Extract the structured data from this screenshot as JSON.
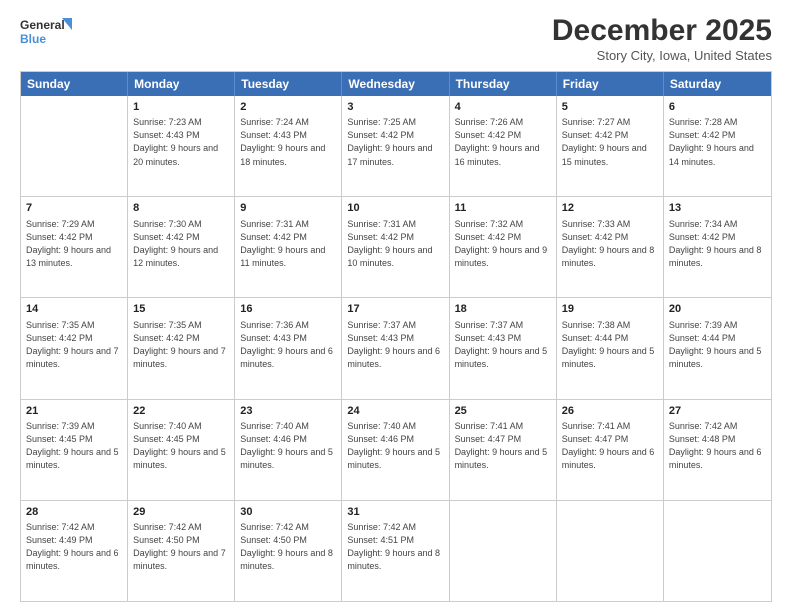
{
  "logo": {
    "line1": "General",
    "line2": "Blue"
  },
  "title": "December 2025",
  "location": "Story City, Iowa, United States",
  "header_days": [
    "Sunday",
    "Monday",
    "Tuesday",
    "Wednesday",
    "Thursday",
    "Friday",
    "Saturday"
  ],
  "weeks": [
    [
      {
        "day": "",
        "sunrise": "",
        "sunset": "",
        "daylight": ""
      },
      {
        "day": "1",
        "sunrise": "Sunrise: 7:23 AM",
        "sunset": "Sunset: 4:43 PM",
        "daylight": "Daylight: 9 hours and 20 minutes."
      },
      {
        "day": "2",
        "sunrise": "Sunrise: 7:24 AM",
        "sunset": "Sunset: 4:43 PM",
        "daylight": "Daylight: 9 hours and 18 minutes."
      },
      {
        "day": "3",
        "sunrise": "Sunrise: 7:25 AM",
        "sunset": "Sunset: 4:42 PM",
        "daylight": "Daylight: 9 hours and 17 minutes."
      },
      {
        "day": "4",
        "sunrise": "Sunrise: 7:26 AM",
        "sunset": "Sunset: 4:42 PM",
        "daylight": "Daylight: 9 hours and 16 minutes."
      },
      {
        "day": "5",
        "sunrise": "Sunrise: 7:27 AM",
        "sunset": "Sunset: 4:42 PM",
        "daylight": "Daylight: 9 hours and 15 minutes."
      },
      {
        "day": "6",
        "sunrise": "Sunrise: 7:28 AM",
        "sunset": "Sunset: 4:42 PM",
        "daylight": "Daylight: 9 hours and 14 minutes."
      }
    ],
    [
      {
        "day": "7",
        "sunrise": "Sunrise: 7:29 AM",
        "sunset": "Sunset: 4:42 PM",
        "daylight": "Daylight: 9 hours and 13 minutes."
      },
      {
        "day": "8",
        "sunrise": "Sunrise: 7:30 AM",
        "sunset": "Sunset: 4:42 PM",
        "daylight": "Daylight: 9 hours and 12 minutes."
      },
      {
        "day": "9",
        "sunrise": "Sunrise: 7:31 AM",
        "sunset": "Sunset: 4:42 PM",
        "daylight": "Daylight: 9 hours and 11 minutes."
      },
      {
        "day": "10",
        "sunrise": "Sunrise: 7:31 AM",
        "sunset": "Sunset: 4:42 PM",
        "daylight": "Daylight: 9 hours and 10 minutes."
      },
      {
        "day": "11",
        "sunrise": "Sunrise: 7:32 AM",
        "sunset": "Sunset: 4:42 PM",
        "daylight": "Daylight: 9 hours and 9 minutes."
      },
      {
        "day": "12",
        "sunrise": "Sunrise: 7:33 AM",
        "sunset": "Sunset: 4:42 PM",
        "daylight": "Daylight: 9 hours and 8 minutes."
      },
      {
        "day": "13",
        "sunrise": "Sunrise: 7:34 AM",
        "sunset": "Sunset: 4:42 PM",
        "daylight": "Daylight: 9 hours and 8 minutes."
      }
    ],
    [
      {
        "day": "14",
        "sunrise": "Sunrise: 7:35 AM",
        "sunset": "Sunset: 4:42 PM",
        "daylight": "Daylight: 9 hours and 7 minutes."
      },
      {
        "day": "15",
        "sunrise": "Sunrise: 7:35 AM",
        "sunset": "Sunset: 4:42 PM",
        "daylight": "Daylight: 9 hours and 7 minutes."
      },
      {
        "day": "16",
        "sunrise": "Sunrise: 7:36 AM",
        "sunset": "Sunset: 4:43 PM",
        "daylight": "Daylight: 9 hours and 6 minutes."
      },
      {
        "day": "17",
        "sunrise": "Sunrise: 7:37 AM",
        "sunset": "Sunset: 4:43 PM",
        "daylight": "Daylight: 9 hours and 6 minutes."
      },
      {
        "day": "18",
        "sunrise": "Sunrise: 7:37 AM",
        "sunset": "Sunset: 4:43 PM",
        "daylight": "Daylight: 9 hours and 5 minutes."
      },
      {
        "day": "19",
        "sunrise": "Sunrise: 7:38 AM",
        "sunset": "Sunset: 4:44 PM",
        "daylight": "Daylight: 9 hours and 5 minutes."
      },
      {
        "day": "20",
        "sunrise": "Sunrise: 7:39 AM",
        "sunset": "Sunset: 4:44 PM",
        "daylight": "Daylight: 9 hours and 5 minutes."
      }
    ],
    [
      {
        "day": "21",
        "sunrise": "Sunrise: 7:39 AM",
        "sunset": "Sunset: 4:45 PM",
        "daylight": "Daylight: 9 hours and 5 minutes."
      },
      {
        "day": "22",
        "sunrise": "Sunrise: 7:40 AM",
        "sunset": "Sunset: 4:45 PM",
        "daylight": "Daylight: 9 hours and 5 minutes."
      },
      {
        "day": "23",
        "sunrise": "Sunrise: 7:40 AM",
        "sunset": "Sunset: 4:46 PM",
        "daylight": "Daylight: 9 hours and 5 minutes."
      },
      {
        "day": "24",
        "sunrise": "Sunrise: 7:40 AM",
        "sunset": "Sunset: 4:46 PM",
        "daylight": "Daylight: 9 hours and 5 minutes."
      },
      {
        "day": "25",
        "sunrise": "Sunrise: 7:41 AM",
        "sunset": "Sunset: 4:47 PM",
        "daylight": "Daylight: 9 hours and 5 minutes."
      },
      {
        "day": "26",
        "sunrise": "Sunrise: 7:41 AM",
        "sunset": "Sunset: 4:47 PM",
        "daylight": "Daylight: 9 hours and 6 minutes."
      },
      {
        "day": "27",
        "sunrise": "Sunrise: 7:42 AM",
        "sunset": "Sunset: 4:48 PM",
        "daylight": "Daylight: 9 hours and 6 minutes."
      }
    ],
    [
      {
        "day": "28",
        "sunrise": "Sunrise: 7:42 AM",
        "sunset": "Sunset: 4:49 PM",
        "daylight": "Daylight: 9 hours and 6 minutes."
      },
      {
        "day": "29",
        "sunrise": "Sunrise: 7:42 AM",
        "sunset": "Sunset: 4:50 PM",
        "daylight": "Daylight: 9 hours and 7 minutes."
      },
      {
        "day": "30",
        "sunrise": "Sunrise: 7:42 AM",
        "sunset": "Sunset: 4:50 PM",
        "daylight": "Daylight: 9 hours and 8 minutes."
      },
      {
        "day": "31",
        "sunrise": "Sunrise: 7:42 AM",
        "sunset": "Sunset: 4:51 PM",
        "daylight": "Daylight: 9 hours and 8 minutes."
      },
      {
        "day": "",
        "sunrise": "",
        "sunset": "",
        "daylight": ""
      },
      {
        "day": "",
        "sunrise": "",
        "sunset": "",
        "daylight": ""
      },
      {
        "day": "",
        "sunrise": "",
        "sunset": "",
        "daylight": ""
      }
    ]
  ]
}
